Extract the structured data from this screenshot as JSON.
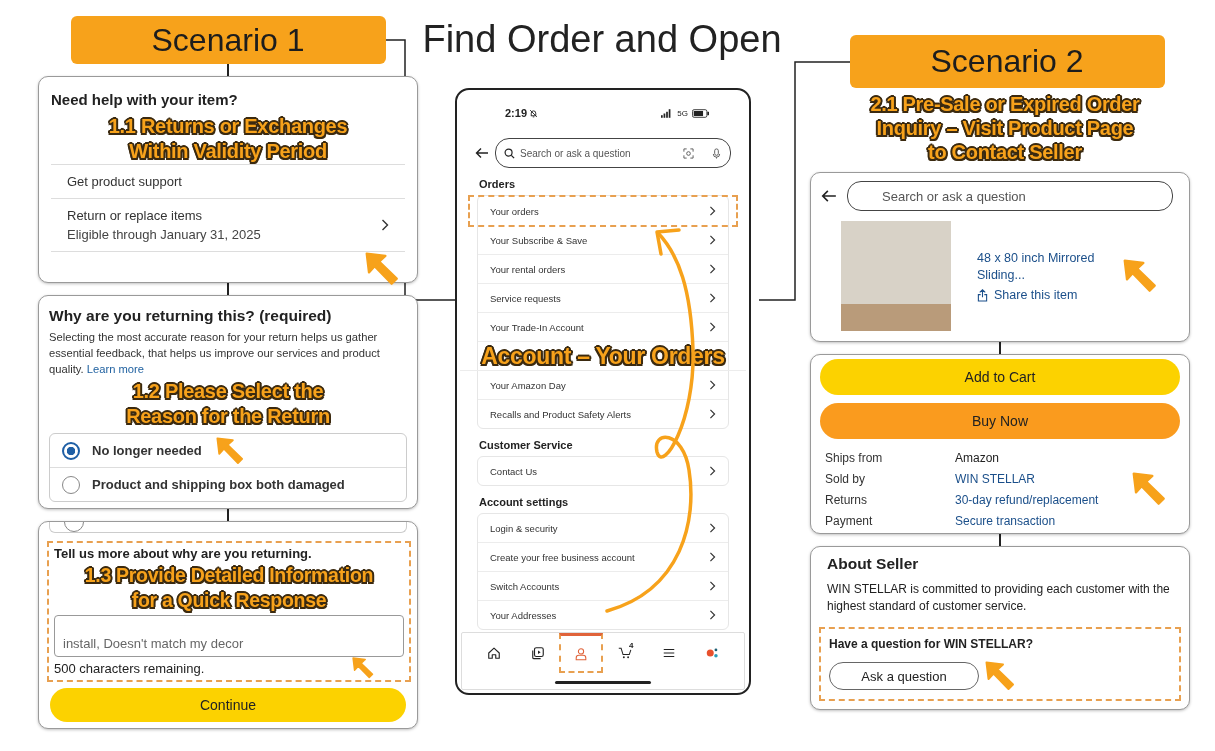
{
  "title": "Find Order and Open",
  "scenario_1": {
    "label": "Scenario 1",
    "help_card": {
      "heading": "Need help with your item?",
      "caption_lines": [
        "1.1 Returns or Exchanges",
        "Within Validity Period"
      ],
      "rows": [
        {
          "title": "Get product support"
        },
        {
          "title": "Return or replace items",
          "subtitle": "Eligible through January 31, 2025"
        }
      ]
    },
    "reason_card": {
      "heading": "Why are you returning this? (required)",
      "description": "Selecting the most accurate reason for your return helps us gather essential feedback, that helps us improve our services and product quality.",
      "link": "Learn more",
      "caption_lines": [
        "1.2 Please Select the",
        "Reason for the Return"
      ],
      "options": [
        {
          "label": "No longer needed",
          "selected": true
        },
        {
          "label": "Product and shipping box both damaged",
          "selected": false
        }
      ]
    },
    "details_card": {
      "label": "Tell us more about why are you returning.",
      "placeholder": "install, Doesn't match my decor",
      "counter": "500 characters remaining.",
      "caption_lines": [
        "1.3 Provide Detailed Information",
        "for a Quick Response"
      ],
      "button": "Continue"
    }
  },
  "phone": {
    "status": {
      "time": "2:19",
      "network": "5G"
    },
    "search": {
      "placeholder": "Search or ask a question"
    },
    "sections": [
      {
        "title": "Orders",
        "items": [
          {
            "kind": "link",
            "label": "Your orders",
            "highlighted": true
          },
          {
            "kind": "link",
            "label": "Your Subscribe & Save",
            "highlighted": false
          },
          {
            "kind": "link",
            "label": "Your rental orders",
            "highlighted": false
          },
          {
            "kind": "link",
            "label": "Service requests",
            "highlighted": false
          },
          {
            "kind": "link",
            "label": "Your Trade-In Account",
            "highlighted": false
          },
          {
            "kind": "caption",
            "label": "Account – Your Orders"
          },
          {
            "kind": "link",
            "label": "Your Amazon Day",
            "highlighted": false
          },
          {
            "kind": "link",
            "label": "Recalls and Product Safety Alerts",
            "highlighted": false
          }
        ]
      },
      {
        "title": "Customer Service",
        "items": [
          {
            "kind": "link",
            "label": "Contact Us",
            "highlighted": false
          }
        ]
      },
      {
        "title": "Account settings",
        "items": [
          {
            "kind": "link",
            "label": "Login & security",
            "highlighted": false
          },
          {
            "kind": "link",
            "label": "Create your free business account",
            "highlighted": false
          },
          {
            "kind": "link",
            "label": "Switch Accounts",
            "highlighted": false
          },
          {
            "kind": "link",
            "label": "Your Addresses",
            "highlighted": false
          }
        ]
      }
    ],
    "nav": [
      {
        "kind": "home",
        "selected": false
      },
      {
        "kind": "video",
        "selected": false
      },
      {
        "kind": "account",
        "selected": true
      },
      {
        "kind": "cart",
        "badge": "4",
        "selected": false
      },
      {
        "kind": "menu",
        "selected": false
      },
      {
        "kind": "assistant",
        "selected": false
      }
    ]
  },
  "scenario_2": {
    "label": "Scenario 2",
    "caption_lines": [
      "2.1 Pre-Sale or Expired Order",
      "Inquiry – Visit Product Page",
      "to Contact Seller"
    ],
    "product_card": {
      "search_placeholder": "Search or ask a question",
      "product_title": "48 x 80 inch Mirrored Sliding...",
      "share": "Share this item"
    },
    "buy_card": {
      "buttons": [
        {
          "label": "Add to Cart",
          "kind": "cart"
        },
        {
          "label": "Buy Now",
          "kind": "buy"
        }
      ],
      "details": [
        {
          "label": "Ships from",
          "value": "Amazon",
          "link": false
        },
        {
          "label": "Sold by",
          "value": "WIN STELLAR",
          "link": true
        },
        {
          "label": "Returns",
          "value": "30-day refund/replacement",
          "link": true
        },
        {
          "label": "Payment",
          "value": "Secure transaction",
          "link": true
        }
      ]
    },
    "seller_card": {
      "heading": "About Seller",
      "text": "WIN STELLAR is committed to providing each customer with the highest standard of customer service.",
      "question": "Have a question for WIN STELLAR?",
      "button": "Ask a question"
    }
  }
}
